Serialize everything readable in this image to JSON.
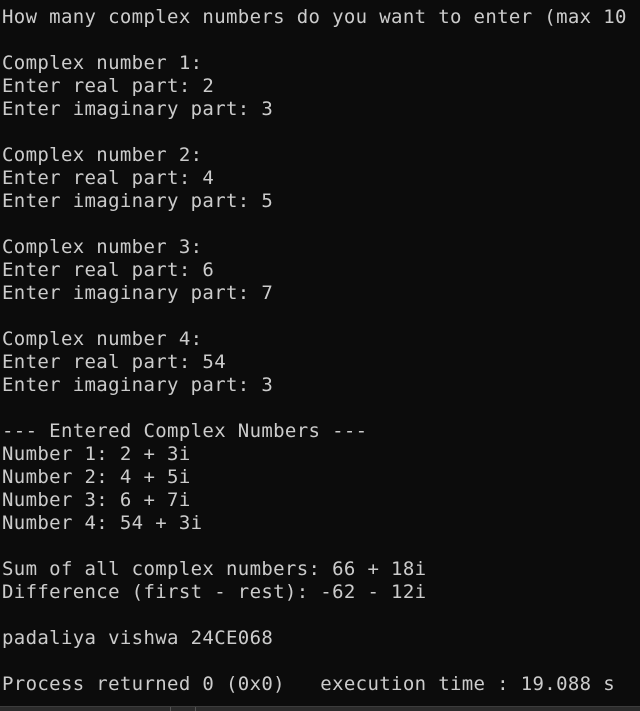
{
  "terminal": {
    "lines": [
      "How many complex numbers do you want to enter (max 10",
      "",
      "Complex number 1:",
      "Enter real part: 2",
      "Enter imaginary part: 3",
      "",
      "Complex number 2:",
      "Enter real part: 4",
      "Enter imaginary part: 5",
      "",
      "Complex number 3:",
      "Enter real part: 6",
      "Enter imaginary part: 7",
      "",
      "Complex number 4:",
      "Enter real part: 54",
      "Enter imaginary part: 3",
      "",
      "--- Entered Complex Numbers ---",
      "Number 1: 2 + 3i",
      "Number 2: 4 + 5i",
      "Number 3: 6 + 7i",
      "Number 4: 54 + 3i",
      "",
      "Sum of all complex numbers: 66 + 18i",
      "Difference (first - rest): -62 - 12i",
      "",
      "padaliya vishwa 24CE068",
      "",
      "Process returned 0 (0x0)   execution time : 19.088 s"
    ]
  },
  "colors": {
    "background": "#0c0c0c",
    "text": "#cccccc"
  }
}
